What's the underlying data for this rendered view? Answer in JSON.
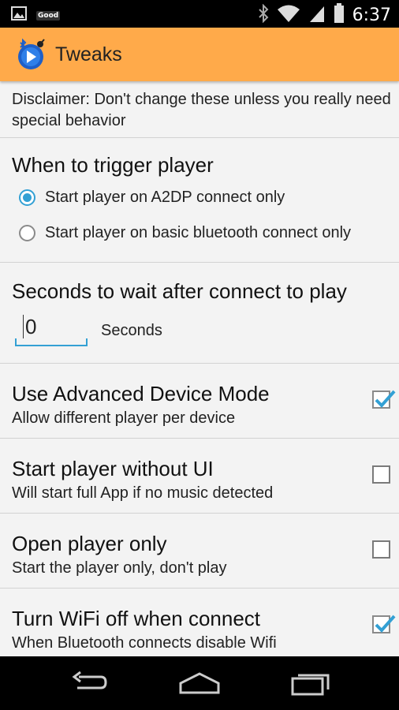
{
  "status_bar": {
    "badge": "Good",
    "time": "6:37",
    "icons": [
      "image-icon",
      "bluetooth-icon",
      "wifi-icon",
      "signal-icon",
      "battery-icon"
    ]
  },
  "action_bar": {
    "title": "Tweaks",
    "color": "#FFAA4A"
  },
  "disclaimer": {
    "text": "Disclaimer: Don't change these unless you really need special behavior"
  },
  "trigger": {
    "title": "When to trigger player",
    "options": [
      {
        "label": "Start player on A2DP connect only",
        "selected": true
      },
      {
        "label": "Start player on basic bluetooth connect only",
        "selected": false
      }
    ]
  },
  "wait": {
    "title": "Seconds to wait after connect to play",
    "value": "0",
    "unit": "Seconds"
  },
  "prefs": [
    {
      "title": "Use Advanced Device Mode",
      "summary": "Allow different player per device",
      "checked": true
    },
    {
      "title": "Start player without UI",
      "summary": "Will start full App if no music detected",
      "checked": false
    },
    {
      "title": "Open player only",
      "summary": "Start the player only, don't play",
      "checked": false
    },
    {
      "title": "Turn WiFi off when connect",
      "summary": "When Bluetooth connects disable Wifi",
      "checked": true
    }
  ],
  "accent_color": "#33A0D4",
  "nav_bar": {
    "icons": [
      "back-icon",
      "home-icon",
      "recents-icon"
    ]
  }
}
